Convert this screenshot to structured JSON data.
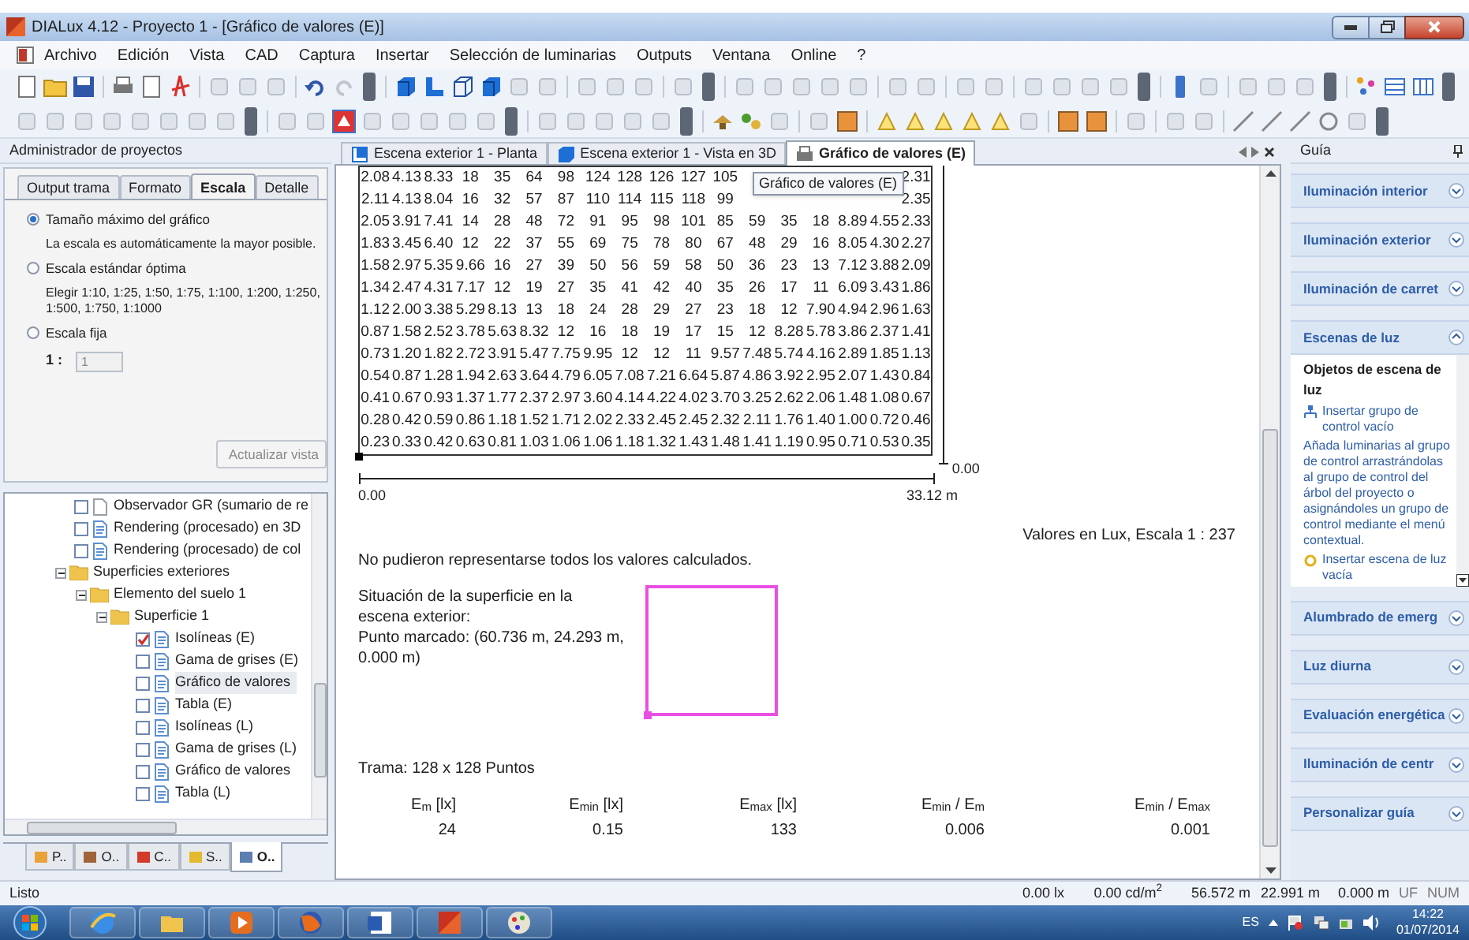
{
  "window": {
    "title": "DIALux 4.12 - Proyecto 1 - [Gráfico de valores (E)]"
  },
  "menu": [
    "Archivo",
    "Edición",
    "Vista",
    "CAD",
    "Captura",
    "Insertar",
    "Selección de luminarias",
    "Outputs",
    "Ventana",
    "Online",
    "?"
  ],
  "project_manager": {
    "title": "Administrador de proyectos",
    "tabs": [
      {
        "label": "Output trama",
        "selected": false
      },
      {
        "label": "Formato",
        "selected": false
      },
      {
        "label": "Escala",
        "selected": true
      },
      {
        "label": "Detalle",
        "selected": false
      }
    ],
    "options": [
      {
        "label": "Tamaño máximo del gráfico",
        "selected": true,
        "note": "La escala es automáticamente la mayor posible."
      },
      {
        "label": "Escala estándar óptima",
        "selected": false,
        "note": "Elegir 1:10, 1:25, 1:50, 1:75, 1:100, 1:200, 1:250, 1:500, 1:750, 1:1000"
      },
      {
        "label": "Escala fija",
        "selected": false
      }
    ],
    "scale_prefix": "1 :",
    "scale_value": "1",
    "update_button": {
      "label": "Actualizar vista",
      "disabled": true
    },
    "tree": [
      {
        "kind": "report",
        "label": "Observador GR (sumario de re",
        "checked": false,
        "selected": false,
        "blank": true
      },
      {
        "kind": "report",
        "label": "Rendering (procesado) en 3D",
        "checked": false,
        "selected": false
      },
      {
        "kind": "report",
        "label": "Rendering (procesado) de col",
        "checked": false,
        "selected": false
      },
      {
        "kind": "folder",
        "label": "Superficies exteriores",
        "expanded": true,
        "children": [
          {
            "kind": "folder",
            "label": "Elemento del suelo 1",
            "expanded": true,
            "children": [
              {
                "kind": "folder",
                "label": "Superficie 1",
                "expanded": true,
                "children": [
                  {
                    "kind": "report",
                    "label": "Isolíneas (E)",
                    "checked": true,
                    "selected": false
                  },
                  {
                    "kind": "report",
                    "label": "Gama de grises (E)",
                    "checked": false,
                    "selected": false
                  },
                  {
                    "kind": "report",
                    "label": "Gráfico de valores",
                    "checked": false,
                    "selected": true
                  },
                  {
                    "kind": "report",
                    "label": "Tabla (E)",
                    "checked": false,
                    "selected": false
                  },
                  {
                    "kind": "report",
                    "label": "Isolíneas (L)",
                    "checked": false,
                    "selected": false
                  },
                  {
                    "kind": "report",
                    "label": "Gama de grises (L)",
                    "checked": false,
                    "selected": false
                  },
                  {
                    "kind": "report",
                    "label": "Gráfico de valores",
                    "checked": false,
                    "selected": false
                  },
                  {
                    "kind": "report",
                    "label": "Tabla (L)",
                    "checked": false,
                    "selected": false
                  }
                ]
              }
            ]
          }
        ]
      }
    ],
    "bottom_tabs": [
      {
        "label": "P..",
        "selected": false
      },
      {
        "label": "O..",
        "selected": false
      },
      {
        "label": "C..",
        "selected": false
      },
      {
        "label": "S..",
        "selected": false
      },
      {
        "label": "O..",
        "selected": true
      }
    ]
  },
  "document_tabs": [
    {
      "label": "Escena exterior 1 - Planta",
      "selected": false
    },
    {
      "label": "Escena exterior 1 - Vista en 3D",
      "selected": false
    },
    {
      "label": "Gráfico de valores (E)",
      "selected": true
    }
  ],
  "tooltip": "Gráfico de valores (E)",
  "value_chart": {
    "rows": [
      [
        "2.08",
        "4.13",
        "8.33",
        "18",
        "35",
        "64",
        "98",
        "124",
        "128",
        "126",
        "127",
        "105",
        null,
        null,
        null,
        null,
        null,
        "2.31"
      ],
      [
        "2.11",
        "4.13",
        "8.04",
        "16",
        "32",
        "57",
        "87",
        "110",
        "114",
        "115",
        "118",
        "99",
        null,
        null,
        null,
        null,
        null,
        "2.35"
      ],
      [
        "2.05",
        "3.91",
        "7.41",
        "14",
        "28",
        "48",
        "72",
        "91",
        "95",
        "98",
        "101",
        "85",
        "59",
        "35",
        "18",
        "8.89",
        "4.55",
        "2.33"
      ],
      [
        "1.83",
        "3.45",
        "6.40",
        "12",
        "22",
        "37",
        "55",
        "69",
        "75",
        "78",
        "80",
        "67",
        "48",
        "29",
        "16",
        "8.05",
        "4.30",
        "2.27"
      ],
      [
        "1.58",
        "2.97",
        "5.35",
        "9.66",
        "16",
        "27",
        "39",
        "50",
        "56",
        "59",
        "58",
        "50",
        "36",
        "23",
        "13",
        "7.12",
        "3.88",
        "2.09"
      ],
      [
        "1.34",
        "2.47",
        "4.31",
        "7.17",
        "12",
        "19",
        "27",
        "35",
        "41",
        "42",
        "40",
        "35",
        "26",
        "17",
        "11",
        "6.09",
        "3.43",
        "1.86"
      ],
      [
        "1.12",
        "2.00",
        "3.38",
        "5.29",
        "8.13",
        "13",
        "18",
        "24",
        "28",
        "29",
        "27",
        "23",
        "18",
        "12",
        "7.90",
        "4.94",
        "2.96",
        "1.63"
      ],
      [
        "0.87",
        "1.58",
        "2.52",
        "3.78",
        "5.63",
        "8.32",
        "12",
        "16",
        "18",
        "19",
        "17",
        "15",
        "12",
        "8.28",
        "5.78",
        "3.86",
        "2.37",
        "1.41"
      ],
      [
        "0.73",
        "1.20",
        "1.82",
        "2.72",
        "3.91",
        "5.47",
        "7.75",
        "9.95",
        "12",
        "12",
        "11",
        "9.57",
        "7.48",
        "5.74",
        "4.16",
        "2.89",
        "1.85",
        "1.13"
      ],
      [
        "0.54",
        "0.87",
        "1.28",
        "1.94",
        "2.63",
        "3.64",
        "4.79",
        "6.05",
        "7.08",
        "7.21",
        "6.64",
        "5.87",
        "4.86",
        "3.92",
        "2.95",
        "2.07",
        "1.43",
        "0.84"
      ],
      [
        "0.41",
        "0.67",
        "0.93",
        "1.37",
        "1.77",
        "2.37",
        "2.97",
        "3.60",
        "4.14",
        "4.22",
        "4.02",
        "3.70",
        "3.25",
        "2.62",
        "2.06",
        "1.48",
        "1.08",
        "0.67"
      ],
      [
        "0.28",
        "0.42",
        "0.59",
        "0.86",
        "1.18",
        "1.52",
        "1.71",
        "2.02",
        "2.33",
        "2.45",
        "2.45",
        "2.32",
        "2.11",
        "1.76",
        "1.40",
        "1.00",
        "0.72",
        "0.46"
      ],
      [
        "0.23",
        "0.33",
        "0.42",
        "0.63",
        "0.81",
        "1.03",
        "1.06",
        "1.06",
        "1.18",
        "1.32",
        "1.43",
        "1.48",
        "1.41",
        "1.19",
        "0.95",
        "0.71",
        "0.53",
        "0.35"
      ]
    ],
    "y_end": "0.00",
    "x_start": "0.00",
    "x_end": "33.12 m",
    "legend": "Valores en Lux, Escala 1 : 237"
  },
  "warning": "No pudieron representarse todos los valores calculados.",
  "location": {
    "text": "Situación de la superficie en la escena exterior:",
    "point": "Punto marcado: (60.736 m, 24.293 m, 0.000 m)"
  },
  "grid_info": "Trama: 128 x 128 Puntos",
  "stats": [
    {
      "label": "E$_{m}$ [lx]",
      "value": "24"
    },
    {
      "label": "E$_{min}$ [lx]",
      "value": "0.15"
    },
    {
      "label": "E$_{max}$ [lx]",
      "value": "133"
    },
    {
      "label": "E$_{min}$ / E$_{m}$",
      "value": "0.006"
    },
    {
      "label": "E$_{min}$ / E$_{max}$",
      "value": "0.001"
    }
  ],
  "guide": {
    "title": "Guía",
    "sections": [
      {
        "label": "Iluminación interior",
        "expanded": false
      },
      {
        "label": "Iluminación exterior",
        "expanded": false
      },
      {
        "label": "Iluminación de carret",
        "expanded": false
      },
      {
        "label": "Escenas de luz",
        "expanded": true,
        "heading": "Objetos de escena de luz",
        "items": [
          {
            "kind": "action",
            "text": "Insertar grupo de control vacío"
          },
          {
            "kind": "paragraph",
            "text": "Añada luminarias al grupo de control arrastrándolas al grupo de control del árbol del proyecto o asignándoles un grupo de control mediante el menú contextual."
          },
          {
            "kind": "bulb_action",
            "text": "Insertar escena de luz vacía"
          }
        ]
      },
      {
        "label": "Alumbrado de emerg",
        "expanded": false
      },
      {
        "label": "Luz diurna",
        "expanded": false
      },
      {
        "label": "Evaluación energética",
        "expanded": false
      },
      {
        "label": "Iluminación de centr",
        "expanded": false
      },
      {
        "label": "Personalizar guía",
        "expanded": false
      }
    ]
  },
  "status_bar": {
    "text": "Listo",
    "fields": [
      "0.00 lx",
      "0.00 cd/m$^{2}$",
      "56.572 m",
      "22.991 m",
      "0.000 m",
      "UF",
      "NUM"
    ]
  },
  "taskbar": {
    "language": "ES",
    "time": "14:22",
    "date": "01/07/2014"
  }
}
